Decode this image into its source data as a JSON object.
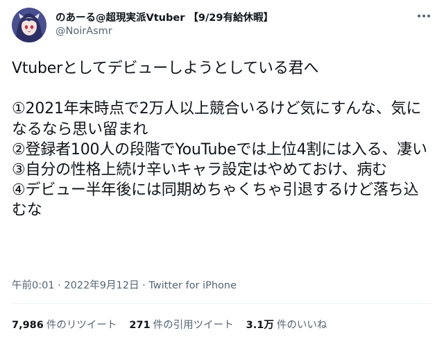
{
  "author": {
    "display_name": "のあーる@超現実派Vtuber 【9/29有給休暇】",
    "handle": "@NoirAsmr",
    "avatar_icon": "avatar-icon"
  },
  "tweet": {
    "text": "Vtuberとしてデビューしようとしている君へ\n\n①2021年末時点で2万人以上競合いるけど気にすんな、気になるなら思い留まれ\n②登録者100人の段階でYouTubeでは上位4割には入る、凄い\n③自分の性格上続け辛いキャラ設定はやめておけ、病む\n④デビュー半年後には同期めちゃくちゃ引退するけど落ち込むな",
    "time": "午前0:01",
    "separator": "·",
    "date": "2022年9月12日",
    "source": "Twitter for iPhone"
  },
  "stats": {
    "retweets_count": "7,986",
    "retweets_label": "件のリツイート",
    "quotes_count": "271",
    "quotes_label": "件の引用ツイート",
    "likes_count": "3.1万",
    "likes_label": "件のいいね"
  },
  "colors": {
    "text": "#0f1419",
    "muted": "#536471",
    "divider": "#eff3f4"
  }
}
